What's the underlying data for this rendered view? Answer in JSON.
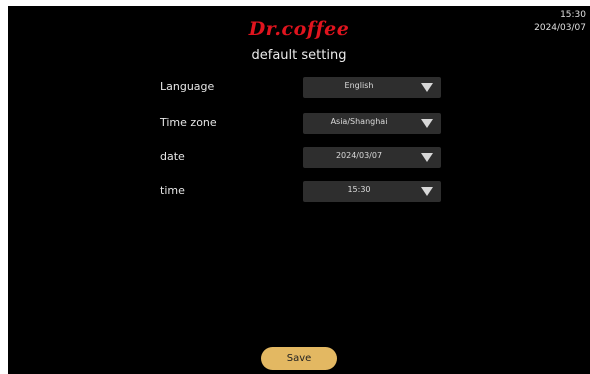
{
  "header": {
    "brand": "Dr.coffee",
    "title": "default setting",
    "clock_time": "15:30",
    "clock_date": "2024/03/07"
  },
  "settings": [
    {
      "label": "Language",
      "value": "English"
    },
    {
      "label": "Time zone",
      "value": "Asia/Shanghai"
    },
    {
      "label": "date",
      "value": "2024/03/07"
    },
    {
      "label": "time",
      "value": "15:30"
    }
  ],
  "footer": {
    "save_label": "Save"
  },
  "theme": {
    "background": "#000000",
    "brand_color": "#e0141e",
    "select_bg": "#2e2e2e",
    "save_color": "#e3b862"
  },
  "icons": {
    "dropdown": "chevron-down-icon"
  }
}
